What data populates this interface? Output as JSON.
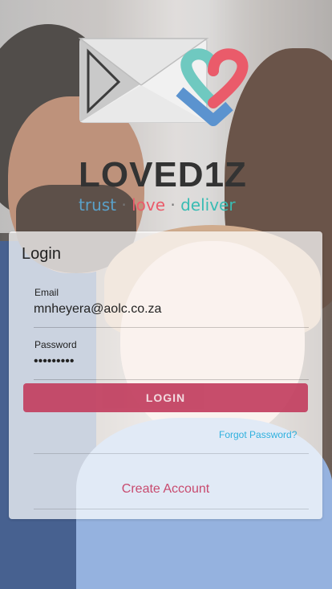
{
  "brand": {
    "name": "LOVED1Z",
    "tagline_trust": "trust",
    "tagline_sep": "·",
    "tagline_love": "love",
    "tagline_deliver": "deliver",
    "colors": {
      "teal": "#39bcb3",
      "coral": "#ea5b6a",
      "blue": "#5aa0c8",
      "envelope": "#f2f2f2"
    }
  },
  "login": {
    "title": "Login",
    "email_label": "Email",
    "email_value": "mnheyera@aolc.co.za",
    "password_label": "Password",
    "password_value": "•••••••••",
    "submit_label": "LOGIN",
    "forgot_label": "Forgot Password?",
    "create_account_label": "Create Account",
    "accent_color": "#c23f5f"
  },
  "icons": {
    "logo": "envelope-heart-logo"
  }
}
